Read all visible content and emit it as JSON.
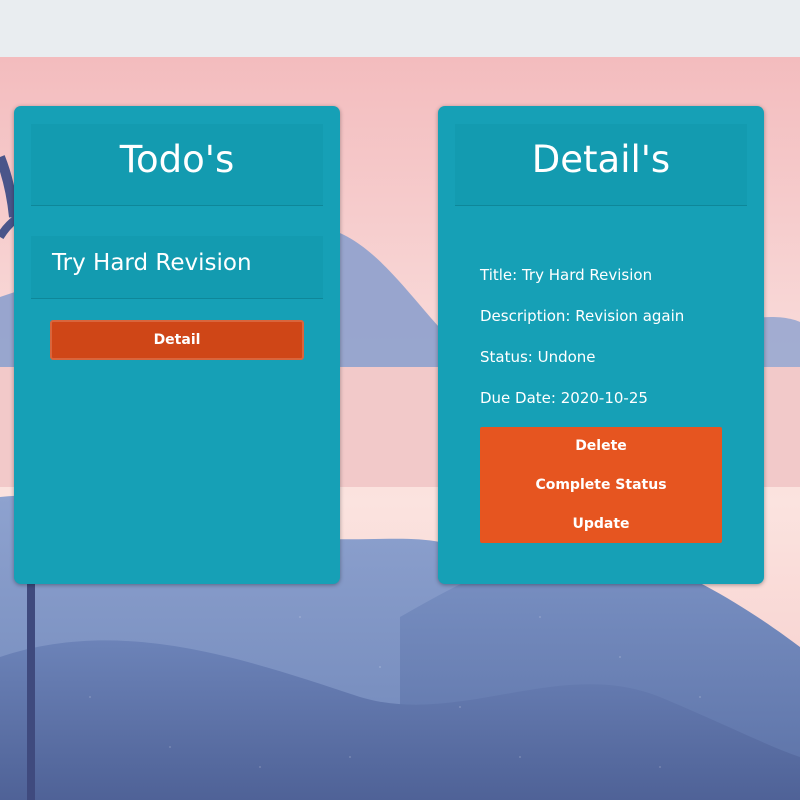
{
  "todo_card": {
    "title": "Todo's",
    "items": [
      {
        "title": "Try Hard Revision",
        "detail_label": "Detail"
      }
    ]
  },
  "detail_card": {
    "title": "Detail's",
    "title_line": "Title: Try Hard Revision",
    "description_line": "Description: Revision again",
    "status_line": "Status: Undone",
    "due_line": "Due Date: 2020-10-25",
    "buttons": {
      "delete": "Delete",
      "complete_status": "Complete Status",
      "update": "Update"
    }
  },
  "colors": {
    "card": "#16a0b6",
    "card_header": "#139bb0",
    "detail_button": "#cf4617",
    "action_buttons": "#e65520",
    "sky_top": "#f3c2c3",
    "hills": "#6f86b8"
  }
}
